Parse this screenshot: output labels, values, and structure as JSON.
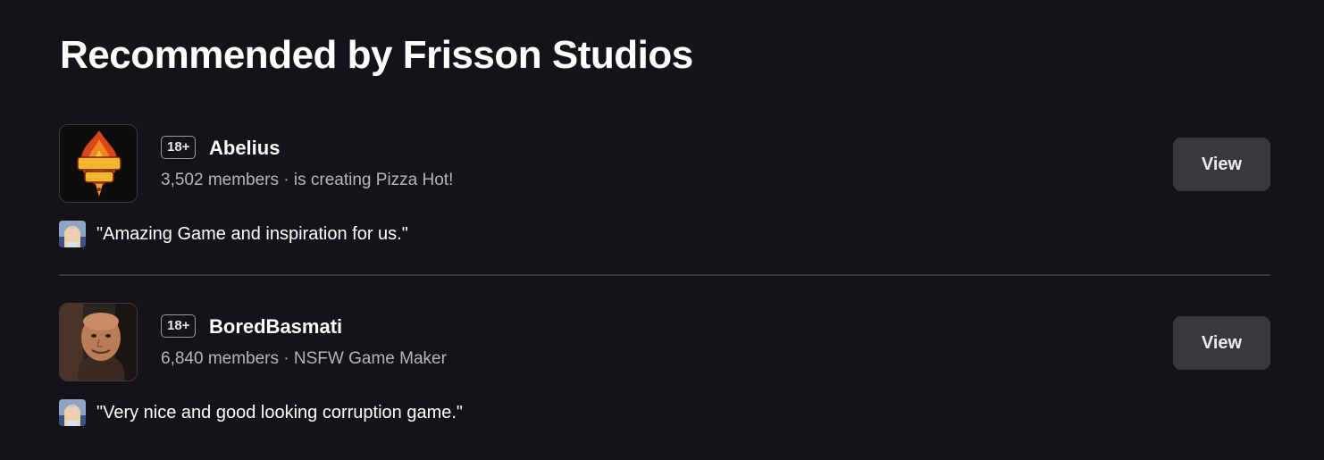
{
  "section": {
    "title": "Recommended by Frisson Studios"
  },
  "recommendations": [
    {
      "badge": "18+",
      "name": "Abelius",
      "meta": "3,502 members · is creating Pizza Hot!",
      "button_label": "View",
      "quote": "\"Amazing Game and inspiration for us.\""
    },
    {
      "badge": "18+",
      "name": "BoredBasmati",
      "meta": "6,840 members · NSFW Game Maker",
      "button_label": "View",
      "quote": "\"Very nice and good looking corruption game.\""
    }
  ],
  "colors": {
    "background": "#151317",
    "button": "#3a383e",
    "muted_text": "#b8b5bc"
  }
}
